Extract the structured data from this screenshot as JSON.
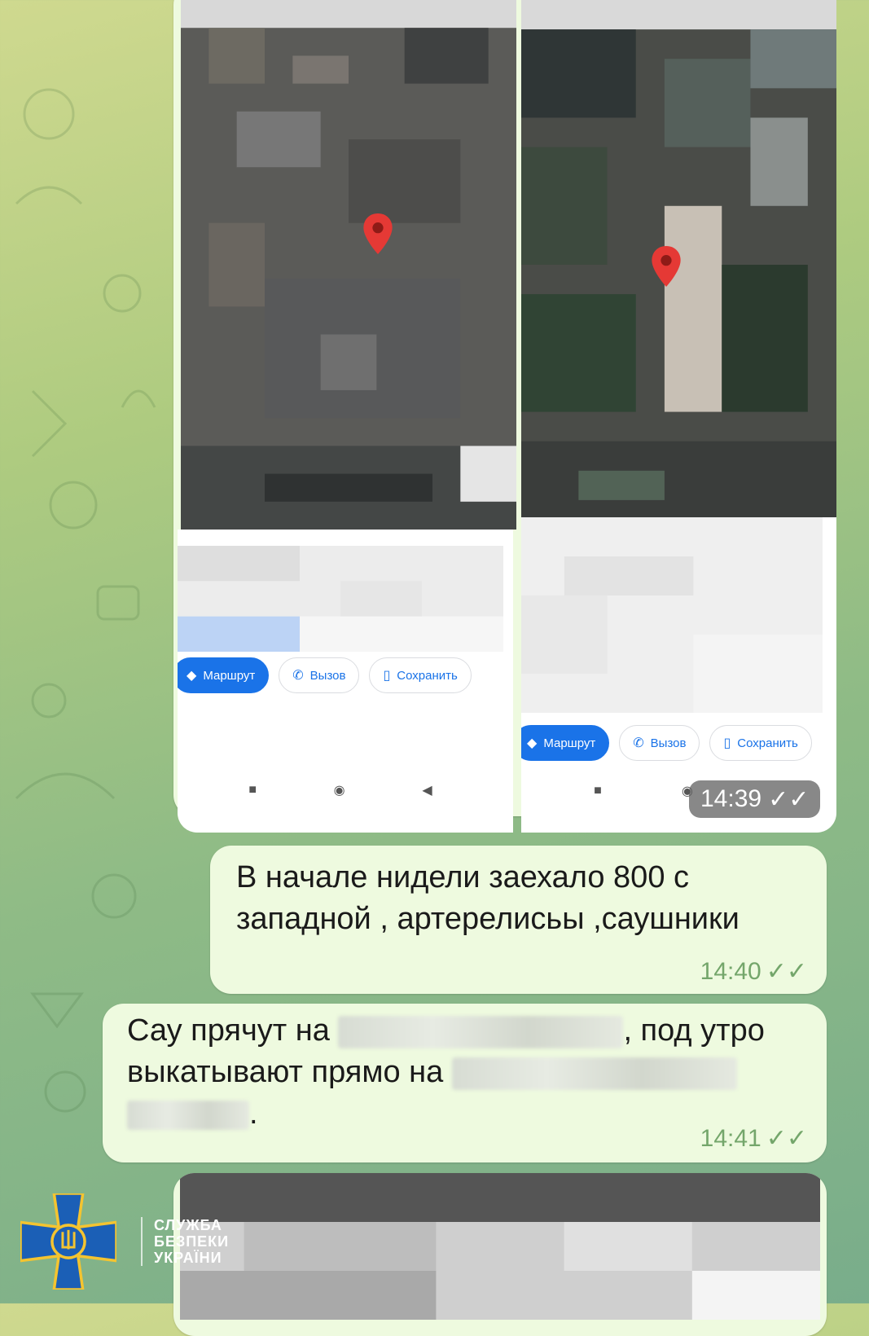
{
  "map_card": {
    "left_actions": {
      "route": "Маршрут",
      "call": "Вызов",
      "save": "Сохранить"
    },
    "right_actions": {
      "route": "Маршрут",
      "call": "Вызов",
      "save": "Сохранить"
    },
    "time": "14:39"
  },
  "messages": [
    {
      "lines": [
        "В начале нидели заехало 800 с",
        "западной , артерелисьы ,саушники"
      ],
      "time": "14:40"
    },
    {
      "line1_prefix": "Сау прячут на",
      "line1_suffix": ", под утро",
      "line2_prefix": "выкатывают прямо на",
      "line3_suffix": ".",
      "time": "14:41"
    }
  ],
  "logo": {
    "line1": "СЛУЖБА",
    "line2": "БЕЗПЕКИ",
    "line3": "УКРАЇНИ"
  },
  "colors": {
    "primary_blue": "#1a73e8",
    "bubble": "#eefadf",
    "check_green": "#74a66b",
    "map_pin": "#e53935",
    "sbu_blue": "#1b5fb6",
    "sbu_gold": "#f4c430"
  },
  "icons": [
    "map-pin-icon",
    "route-icon",
    "phone-icon",
    "bookmark-icon",
    "double-check-icon",
    "square-nav-icon",
    "circle-nav-icon",
    "back-nav-icon",
    "sbu-emblem-icon"
  ]
}
